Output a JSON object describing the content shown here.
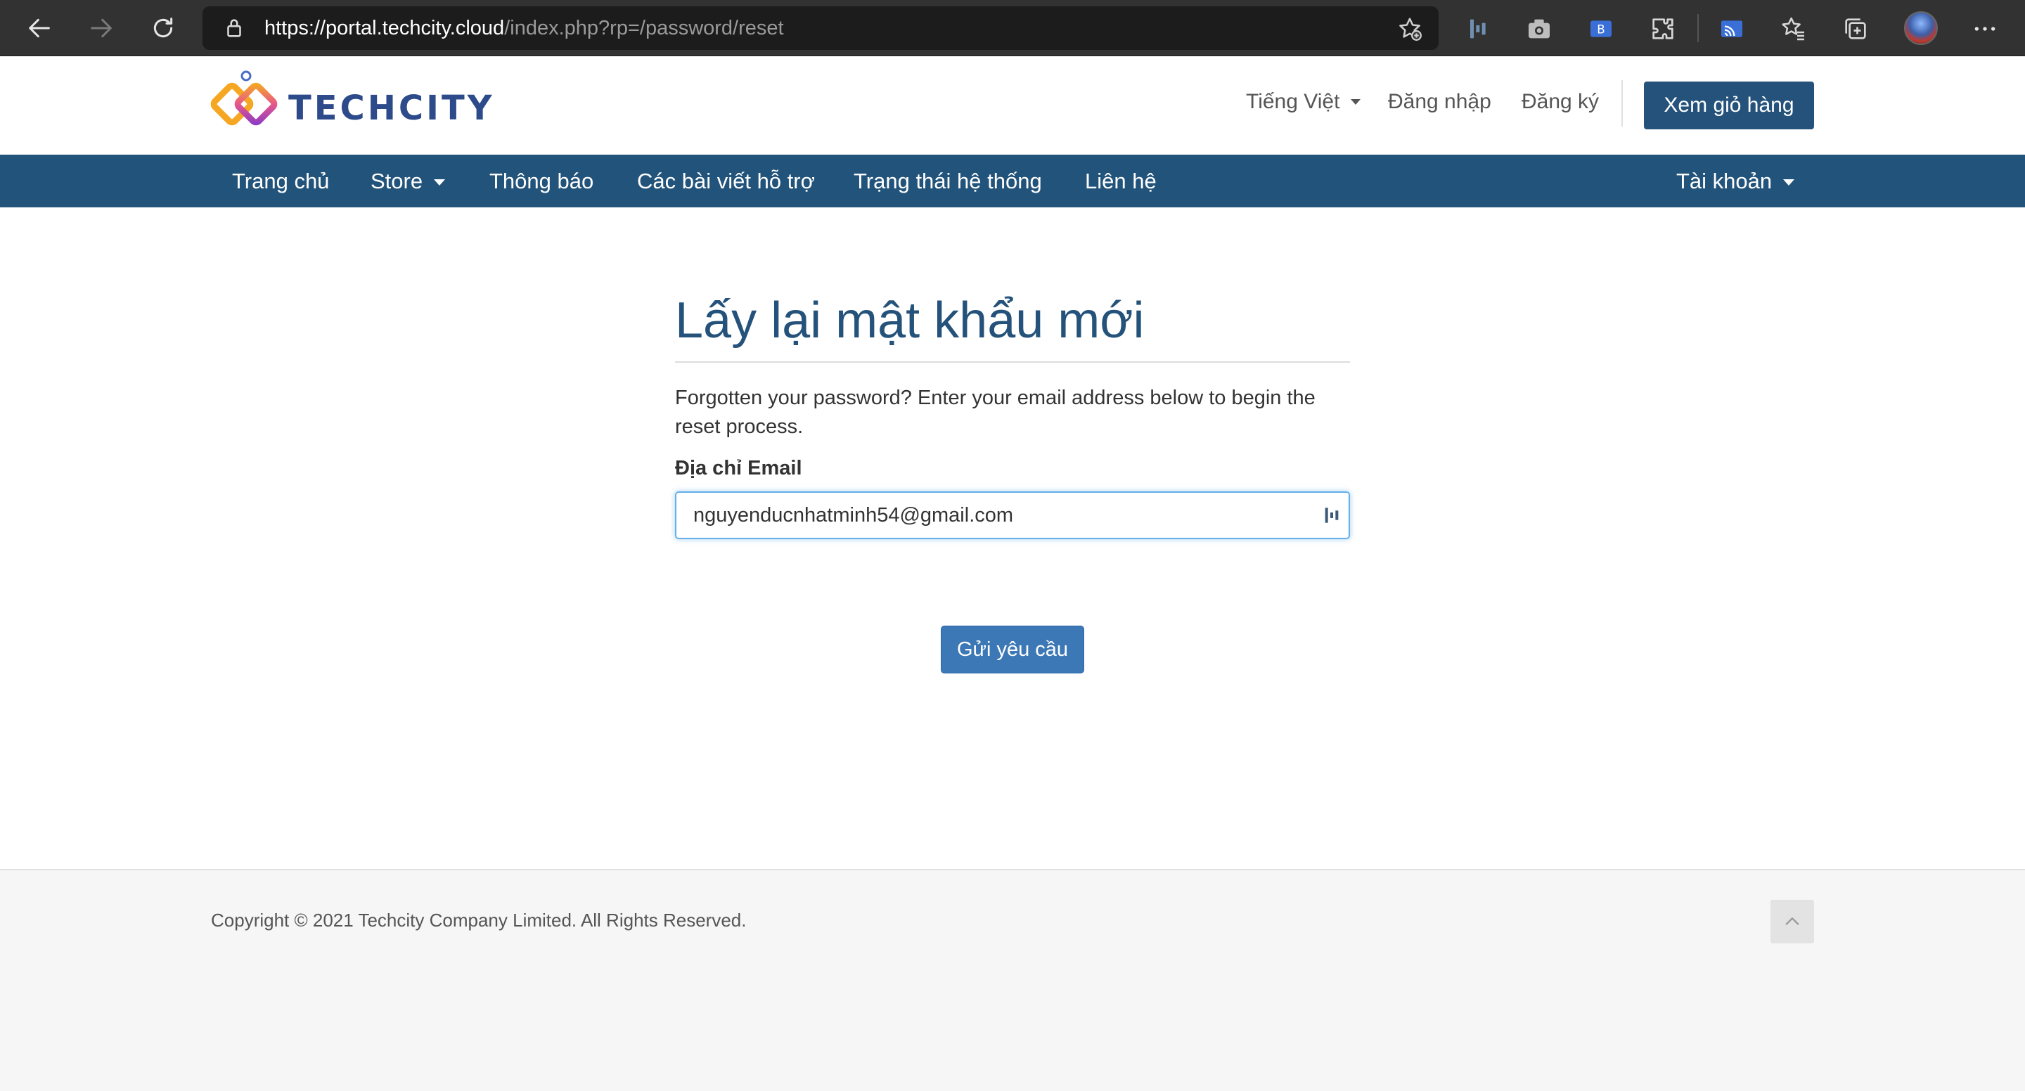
{
  "browser": {
    "url_host": "https://portal.techcity.cloud",
    "url_path": "/index.php?rp=/password/reset"
  },
  "header": {
    "logo_text": "TECHCITY",
    "language": "Tiếng Việt",
    "login": "Đăng nhập",
    "register": "Đăng ký",
    "cart_button": "Xem giỏ hàng"
  },
  "nav": {
    "items": [
      "Trang chủ",
      "Store",
      "Thông báo",
      "Các bài viết hỗ trợ",
      "Trạng thái hệ thống",
      "Liên hệ"
    ],
    "account": "Tài khoản"
  },
  "form": {
    "title": "Lấy lại mật khẩu mới",
    "description": "Forgotten your password? Enter your email address below to begin the reset process.",
    "email_label": "Địa chỉ Email",
    "email_value": "nguyenducnhatminh54@gmail.com",
    "submit": "Gửi yêu cầu"
  },
  "footer": {
    "copyright": "Copyright © 2021 Techcity Company Limited. All Rights Reserved."
  },
  "colors": {
    "brand": "#24527a",
    "nav_bg": "#22537b",
    "button": "#3b78b5"
  }
}
